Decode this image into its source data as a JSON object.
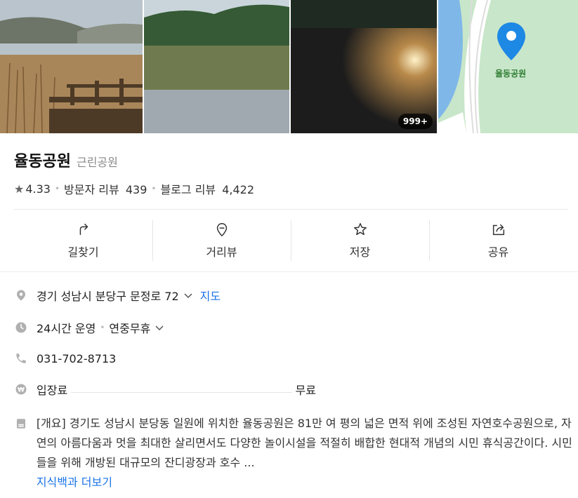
{
  "photos": {
    "count_badge": "999+",
    "map_label": "율동공원"
  },
  "place": {
    "name": "율동공원",
    "category": "근린공원",
    "rating": "4.33",
    "visitor_review_label": "방문자 리뷰",
    "visitor_review_count": "439",
    "blog_review_label": "블로그 리뷰",
    "blog_review_count": "4,422"
  },
  "actions": [
    {
      "label": "길찾기",
      "icon": "directions-icon"
    },
    {
      "label": "거리뷰",
      "icon": "street-view-icon"
    },
    {
      "label": "저장",
      "icon": "star-icon"
    },
    {
      "label": "공유",
      "icon": "share-icon"
    }
  ],
  "info": {
    "address": "경기 성남시 분당구 문정로 72",
    "map_link": "지도",
    "hours_status": "24시간 운영",
    "hours_note": "연중무휴",
    "phone": "031-702-8713",
    "fee_label": "입장료",
    "fee_value": "무료",
    "description": "[개요] 경기도 성남시 분당동 일원에 위치한 율동공원은 81만 여 평의 넓은 면적 위에 조성된 자연호수공원으로, 자연의 아름다움과 멋을 최대한 살리면서도 다양한 놀이시설을 적절히 배합한 현대적 개념의 시민 휴식공간이다. 시민들을 위해 개방된 대규모의 잔디광장과 호수 ...",
    "more_link": "지식백과 더보기"
  },
  "colors": {
    "accent": "#1a73e8",
    "map_pin": "#1e88e5",
    "map_green": "#c8e6c9",
    "map_water": "#7fb8e8"
  }
}
